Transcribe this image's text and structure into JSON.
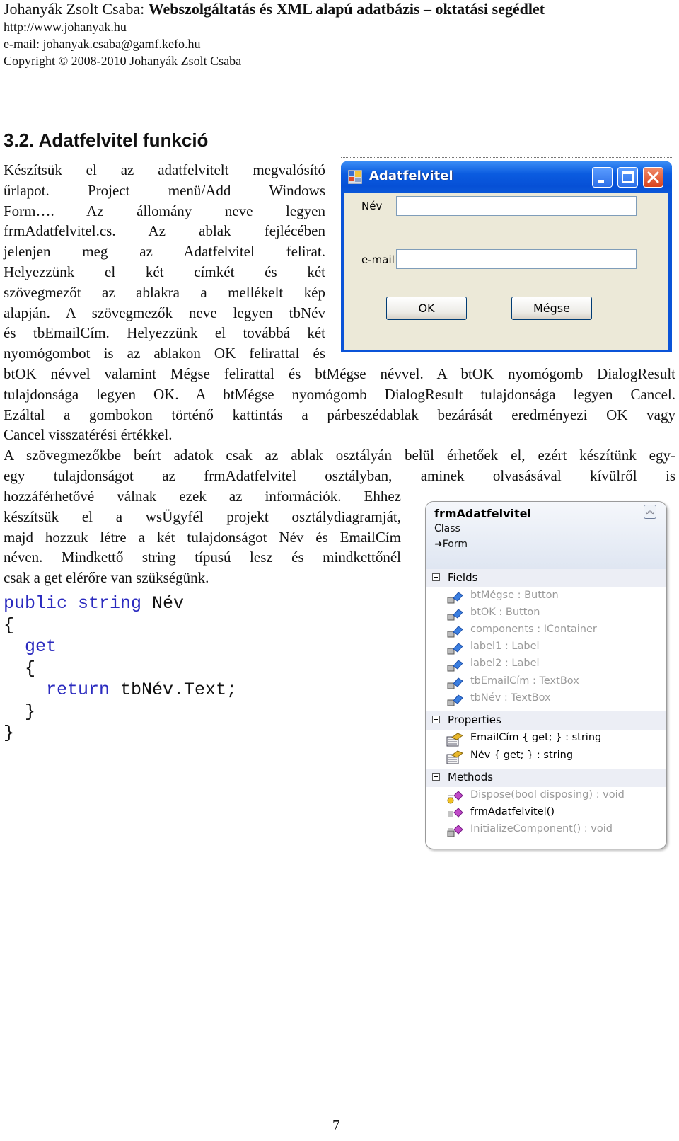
{
  "header": {
    "author": "Johanyák Zsolt Csaba:",
    "title": "Webszolgáltatás és XML alapú adatbázis – oktatási segédlet",
    "url": "http://www.johanyak.hu",
    "email": "e-mail: johanyak.csaba@gamf.kefo.hu",
    "copyright": "Copyright © 2008-2010 Johanyák Zsolt Csaba"
  },
  "section": {
    "heading": "3.2. Adatfelvitel funkció"
  },
  "paragraph1_lines": [
    "Készítsük el az adatfelvitelt megvalósító",
    "űrlapot. Project menü/Add Windows",
    "Form…. Az állomány neve legyen",
    "frmAdatfelvitel.cs. Az ablak fejlécében",
    "jelenjen meg az Adatfelvitel felirat.",
    "Helyezzünk el két címkét és két",
    "szövegmezőt az ablakra a mellékelt kép",
    "alapján. A szövegmezők neve legyen tbNév",
    "és tbEmailCím. Helyezzünk el továbbá két",
    "nyomógombot is az ablakon OK felirattal és"
  ],
  "paragraph1_full_lines": [
    "btOK névvel valamint Mégse felirattal és btMégse névvel. A btOK nyomógomb DialogResult",
    "tulajdonsága legyen OK. A btMégse nyomógomb DialogResult tulajdonsága legyen Cancel.",
    "Ezáltal a gombokon történő kattintás a párbeszédablak bezárását eredményezi OK vagy",
    "Cancel visszatérési értékkel."
  ],
  "paragraph2_full_lines": [
    "A szövegmezőkbe beírt adatok csak az ablak osztályán belül érhetőek el, ezért készítünk egy-",
    "egy tulajdonságot az frmAdatfelvitel osztályban, aminek olvasásával kívülről is"
  ],
  "paragraph2_left_lines": [
    "hozzáférhetővé válnak ezek az információk. Ehhez",
    "készítsük el a wsÜgyfél projekt osztálydiagramját,",
    "majd hozzuk létre a két tulajdonságot Név és EmailCím",
    "néven. Mindkettő string típusú lesz és mindkettőnél",
    "csak a get elérőre van szükségünk."
  ],
  "dialog": {
    "title": "Adatfelvitel",
    "label_name": "Név",
    "label_email": "e-mail",
    "input_name_value": "",
    "input_email_value": "",
    "ok_button": "OK",
    "cancel_button": "Mégse",
    "colors": {
      "titlebar": "#0b5ce0",
      "client": "#ece9d8",
      "close": "#d9431d"
    }
  },
  "code": {
    "line1_kw": "public string",
    "line1_id": " Név",
    "line2": "{",
    "line3_kw": "get",
    "line4": "{",
    "line5_kw": "return",
    "line5_rest": " tbNév.Text;",
    "line6": "}",
    "line7": "}",
    "keyword_color": "#2a2abf"
  },
  "class_diagram": {
    "name": "frmAdatfelvitel",
    "kind": "Class",
    "base": "Form",
    "sections": {
      "fields": {
        "label": "Fields",
        "items": [
          "btMégse : Button",
          "btOK : Button",
          "components : IContainer",
          "label1 : Label",
          "label2 : Label",
          "tbEmailCím : TextBox",
          "tbNév : TextBox"
        ]
      },
      "properties": {
        "label": "Properties",
        "items": [
          "EmailCím { get; } : string",
          "Név { get; } : string"
        ]
      },
      "methods": {
        "label": "Methods",
        "items": [
          "Dispose(bool disposing) : void",
          "frmAdatfelvitel()",
          "InitializeComponent() : void"
        ]
      }
    }
  },
  "page_number": "7"
}
